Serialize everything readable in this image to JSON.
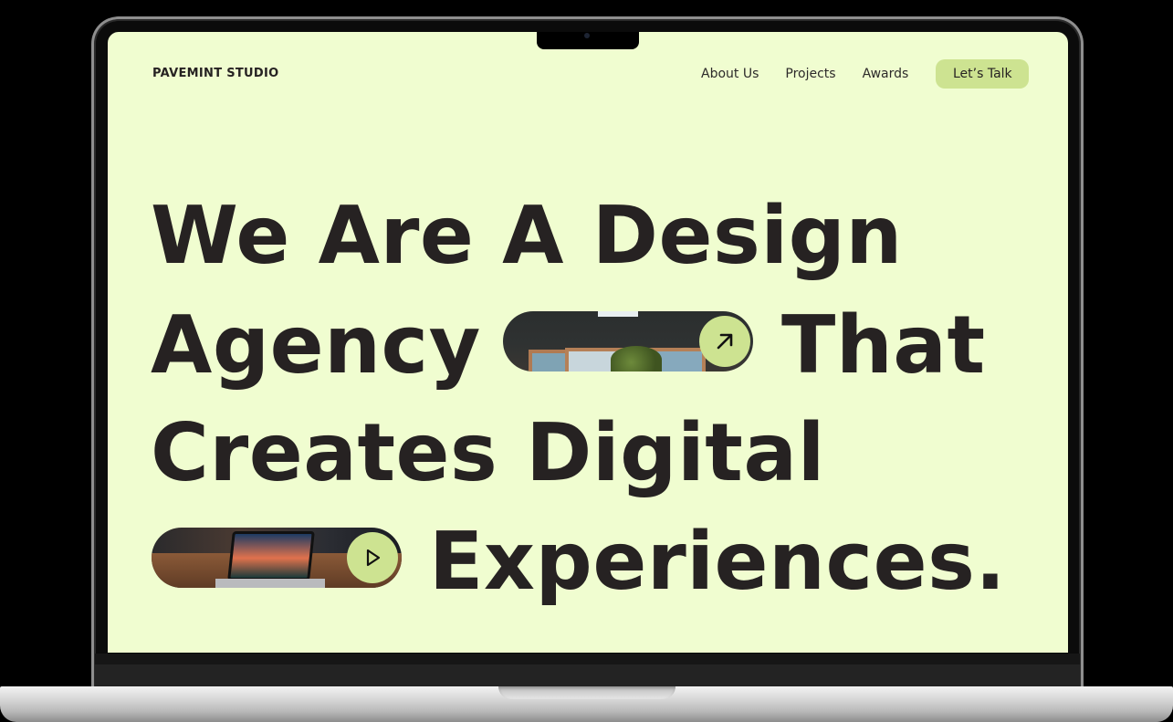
{
  "header": {
    "logo": "PAVEMINT STUDIO",
    "nav": [
      "About Us",
      "Projects",
      "Awards"
    ],
    "cta": "Let’s Talk"
  },
  "hero": {
    "line1": "We Are A Design",
    "line2_left": "Agency",
    "line2_right": "That",
    "line3": "Creates Digital",
    "line4": "Experiences."
  },
  "media": {
    "office_pill_icon": "arrow-up-right-icon",
    "video_pill_icon": "play-icon"
  },
  "colors": {
    "background": "#f0fdd0",
    "accent": "#cde391",
    "text": "#262222"
  }
}
